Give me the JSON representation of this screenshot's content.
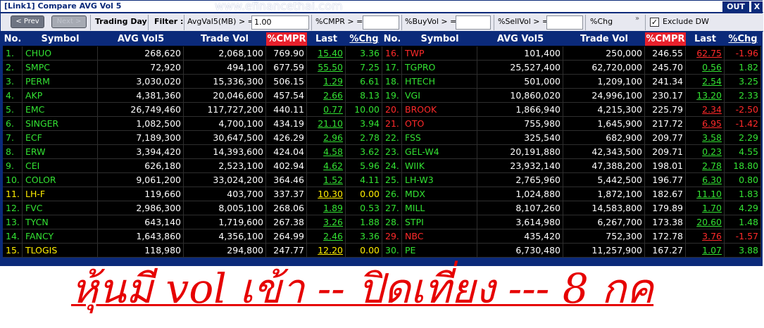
{
  "window": {
    "title": "[Link1] Compare AVG Vol 5",
    "watermark": "www.efinancethai.com",
    "out_label": "OUT",
    "close_label": "X"
  },
  "toolbar": {
    "prev_label": "< Prev",
    "next_label": "Next >",
    "trading_day_label": "Trading Day",
    "filter_label": "Filter :",
    "avgvol5_label": "AvgVal5(MB) > =",
    "avgvol5_value": "1.00",
    "cmpr_label": "%CMPR > =",
    "cmpr_value": "",
    "buyvol_label": "%BuyVol > =",
    "buyvol_value": "",
    "sellvol_label": "%SellVol > =",
    "sellvol_value": "",
    "chg_label": "%Chg",
    "chevron": "»",
    "exclude_dw_label": "Exclude DW",
    "exclude_dw_checked": "✓"
  },
  "table": {
    "headers": [
      "No.",
      "Symbol",
      "AVG Vol5",
      "Trade Vol",
      "%CMPR",
      "Last",
      "%Chg"
    ],
    "left": [
      {
        "no": "1.",
        "symbol": "CHUO",
        "avg": "268,620",
        "trade": "2,068,100",
        "cmpr": "769.90",
        "last": "15.40",
        "chg": "3.36",
        "color": "green"
      },
      {
        "no": "2.",
        "symbol": "SMPC",
        "avg": "72,920",
        "trade": "494,100",
        "cmpr": "677.59",
        "last": "55.50",
        "chg": "7.25",
        "color": "green"
      },
      {
        "no": "3.",
        "symbol": "PERM",
        "avg": "3,030,020",
        "trade": "15,336,300",
        "cmpr": "506.15",
        "last": "1.29",
        "chg": "6.61",
        "color": "green"
      },
      {
        "no": "4.",
        "symbol": "AKP",
        "avg": "4,381,360",
        "trade": "20,046,600",
        "cmpr": "457.54",
        "last": "2.66",
        "chg": "8.13",
        "color": "green"
      },
      {
        "no": "5.",
        "symbol": "EMC",
        "avg": "26,749,460",
        "trade": "117,727,200",
        "cmpr": "440.11",
        "last": "0.77",
        "chg": "10.00",
        "color": "green"
      },
      {
        "no": "6.",
        "symbol": "SINGER",
        "avg": "1,082,500",
        "trade": "4,700,100",
        "cmpr": "434.19",
        "last": "21.10",
        "chg": "3.94",
        "color": "green"
      },
      {
        "no": "7.",
        "symbol": "ECF",
        "avg": "7,189,300",
        "trade": "30,647,500",
        "cmpr": "426.29",
        "last": "2.96",
        "chg": "2.78",
        "color": "green"
      },
      {
        "no": "8.",
        "symbol": "ERW",
        "avg": "3,394,420",
        "trade": "14,393,600",
        "cmpr": "424.04",
        "last": "4.58",
        "chg": "3.62",
        "color": "green"
      },
      {
        "no": "9.",
        "symbol": "CEI",
        "avg": "626,180",
        "trade": "2,523,100",
        "cmpr": "402.94",
        "last": "4.62",
        "chg": "5.96",
        "color": "green"
      },
      {
        "no": "10.",
        "symbol": "COLOR",
        "avg": "9,061,200",
        "trade": "33,024,200",
        "cmpr": "364.46",
        "last": "1.52",
        "chg": "4.11",
        "color": "green"
      },
      {
        "no": "11.",
        "symbol": "LH-F",
        "avg": "119,660",
        "trade": "403,700",
        "cmpr": "337.37",
        "last": "10.30",
        "chg": "0.00",
        "color": "yellow"
      },
      {
        "no": "12.",
        "symbol": "FVC",
        "avg": "2,986,300",
        "trade": "8,005,100",
        "cmpr": "268.06",
        "last": "1.89",
        "chg": "0.53",
        "color": "green"
      },
      {
        "no": "13.",
        "symbol": "TYCN",
        "avg": "643,140",
        "trade": "1,719,600",
        "cmpr": "267.38",
        "last": "3.26",
        "chg": "1.88",
        "color": "green"
      },
      {
        "no": "14.",
        "symbol": "FANCY",
        "avg": "1,643,860",
        "trade": "4,356,100",
        "cmpr": "264.99",
        "last": "2.46",
        "chg": "3.36",
        "color": "green"
      },
      {
        "no": "15.",
        "symbol": "TLOGIS",
        "avg": "118,980",
        "trade": "294,800",
        "cmpr": "247.77",
        "last": "12.20",
        "chg": "0.00",
        "color": "yellow"
      }
    ],
    "right": [
      {
        "no": "16.",
        "symbol": "TWP",
        "avg": "101,400",
        "trade": "250,000",
        "cmpr": "246.55",
        "last": "62.75",
        "chg": "-1.96",
        "color": "red"
      },
      {
        "no": "17.",
        "symbol": "TGPRO",
        "avg": "25,527,400",
        "trade": "62,720,000",
        "cmpr": "245.70",
        "last": "0.56",
        "chg": "1.82",
        "color": "green"
      },
      {
        "no": "18.",
        "symbol": "HTECH",
        "avg": "501,000",
        "trade": "1,209,100",
        "cmpr": "241.34",
        "last": "2.54",
        "chg": "3.25",
        "color": "green"
      },
      {
        "no": "19.",
        "symbol": "VGI",
        "avg": "10,860,020",
        "trade": "24,996,100",
        "cmpr": "230.17",
        "last": "13.20",
        "chg": "2.33",
        "color": "green"
      },
      {
        "no": "20.",
        "symbol": "BROOK",
        "avg": "1,866,940",
        "trade": "4,215,300",
        "cmpr": "225.79",
        "last": "2.34",
        "chg": "-2.50",
        "color": "red"
      },
      {
        "no": "21.",
        "symbol": "OTO",
        "avg": "755,980",
        "trade": "1,645,900",
        "cmpr": "217.72",
        "last": "6.95",
        "chg": "-1.42",
        "color": "red"
      },
      {
        "no": "22.",
        "symbol": "FSS",
        "avg": "325,540",
        "trade": "682,900",
        "cmpr": "209.77",
        "last": "3.58",
        "chg": "2.29",
        "color": "green"
      },
      {
        "no": "23.",
        "symbol": "GEL-W4",
        "avg": "20,191,880",
        "trade": "42,343,500",
        "cmpr": "209.71",
        "last": "0.23",
        "chg": "4.55",
        "color": "green"
      },
      {
        "no": "24.",
        "symbol": "WIIK",
        "avg": "23,932,140",
        "trade": "47,388,200",
        "cmpr": "198.01",
        "last": "2.78",
        "chg": "18.80",
        "color": "green"
      },
      {
        "no": "25.",
        "symbol": "LH-W3",
        "avg": "2,765,960",
        "trade": "5,442,500",
        "cmpr": "196.77",
        "last": "6.30",
        "chg": "0.80",
        "color": "green"
      },
      {
        "no": "26.",
        "symbol": "MDX",
        "avg": "1,024,880",
        "trade": "1,872,100",
        "cmpr": "182.67",
        "last": "11.10",
        "chg": "1.83",
        "color": "green"
      },
      {
        "no": "27.",
        "symbol": "MILL",
        "avg": "8,107,260",
        "trade": "14,583,800",
        "cmpr": "179.89",
        "last": "1.70",
        "chg": "4.29",
        "color": "green"
      },
      {
        "no": "28.",
        "symbol": "STPI",
        "avg": "3,614,980",
        "trade": "6,267,700",
        "cmpr": "173.38",
        "last": "20.60",
        "chg": "1.48",
        "color": "green"
      },
      {
        "no": "29.",
        "symbol": "NBC",
        "avg": "435,420",
        "trade": "752,300",
        "cmpr": "172.78",
        "last": "3.76",
        "chg": "-1.57",
        "color": "red"
      },
      {
        "no": "30.",
        "symbol": "PE",
        "avg": "6,730,480",
        "trade": "11,257,900",
        "cmpr": "167.27",
        "last": "1.07",
        "chg": "3.88",
        "color": "green"
      }
    ]
  },
  "banner": {
    "text": "หุ้นมี vol เข้า -- ปิดเที่ยง --- 8 กค"
  },
  "colors": {
    "green": "#33e233",
    "red": "#ff2a2a",
    "yellow": "#ffee00",
    "header_bg": "#0b2a7a",
    "cmpr_header_bg": "#e8202c",
    "banner": "#e60000"
  }
}
